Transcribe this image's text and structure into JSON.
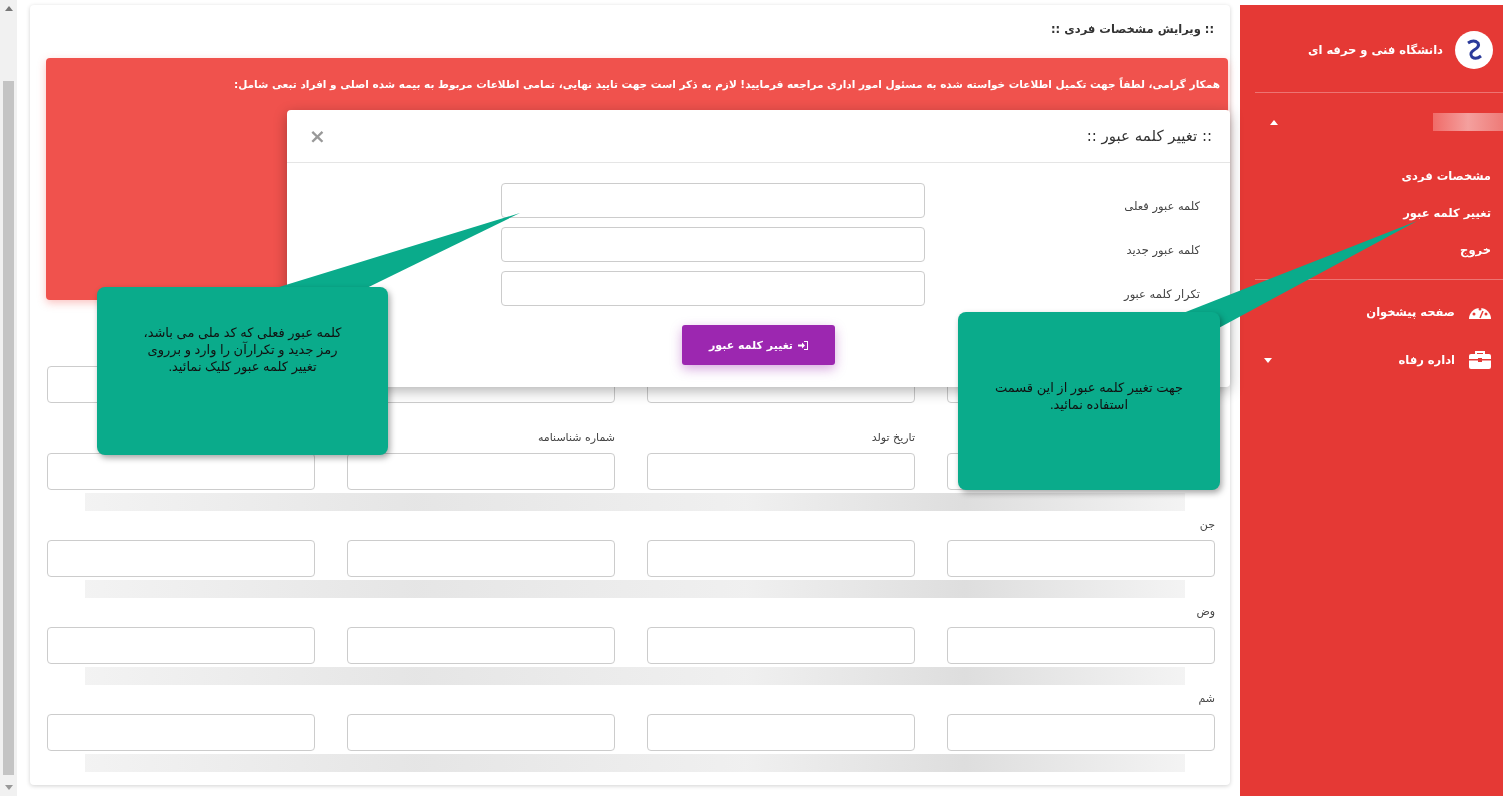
{
  "page": {
    "title": ":: ویرایش مشخصات فردی ::",
    "alert": "همکار گرامی، لطفاً جهت تکمیل اطلاعات خواسته شده به مسئول امور اداری مراجعه فرمایید! لازم به ذکر است جهت تایید نهایی، تمامی اطلاعات مربوط به بیمه شده اصلی و افراد تبعی شامل:",
    "form": {
      "rows": [
        {
          "fields": [
            {
              "kind": "text"
            },
            {
              "kind": "text"
            },
            {
              "kind": "text"
            },
            {
              "kind": "text"
            }
          ]
        },
        {
          "fields": [
            {
              "kind": "text"
            },
            {
              "kind": "text",
              "label": "تاریخ تولد"
            },
            {
              "kind": "text",
              "label": "شماره شناسنامه"
            },
            {
              "kind": "text"
            }
          ]
        },
        {
          "fields": [
            {
              "kind": "text",
              "label": "جن"
            },
            {
              "kind": "text"
            },
            {
              "kind": "text"
            },
            {
              "kind": "text"
            }
          ]
        },
        {
          "fields": [
            {
              "kind": "text",
              "label": "وض"
            },
            {
              "kind": "text"
            },
            {
              "kind": "text"
            },
            {
              "kind": "text"
            }
          ]
        },
        {
          "fields": [
            {
              "kind": "text",
              "label": "شم"
            },
            {
              "kind": "text"
            },
            {
              "kind": "text"
            },
            {
              "kind": "text"
            }
          ]
        }
      ]
    }
  },
  "modal": {
    "title": ":: تغییر کلمه عبور ::",
    "close": "×",
    "fields": [
      {
        "label": "کلمه عبور فعلی"
      },
      {
        "label": "کلمه عبور جدید"
      },
      {
        "label": "تکرار کلمه عبور"
      }
    ],
    "submit": "تغییر کلمه عبور"
  },
  "sidebar": {
    "brand": "دانشگاه فنی و حرفه ای",
    "user_menu": {
      "expanded": true,
      "items": [
        {
          "label": "مشخصات فردی"
        },
        {
          "label": "تغییر کلمه عبور"
        },
        {
          "label": "خروج"
        }
      ]
    },
    "nav": [
      {
        "label": "صفحه پیشخوان",
        "kind": "dashboard"
      },
      {
        "label": "اداره رفاه",
        "kind": "briefcase",
        "expanded": false
      }
    ]
  },
  "callouts": [
    {
      "text": "کلمه عبور فعلی که کد ملی می باشد، رمز جدید و تکرارآن را وارد و برروی تغییر کلمه عبور کلیک نمائید."
    },
    {
      "text": "جهت تغییر کلمه عبور از این قسمت استفاده نمائید."
    }
  ]
}
